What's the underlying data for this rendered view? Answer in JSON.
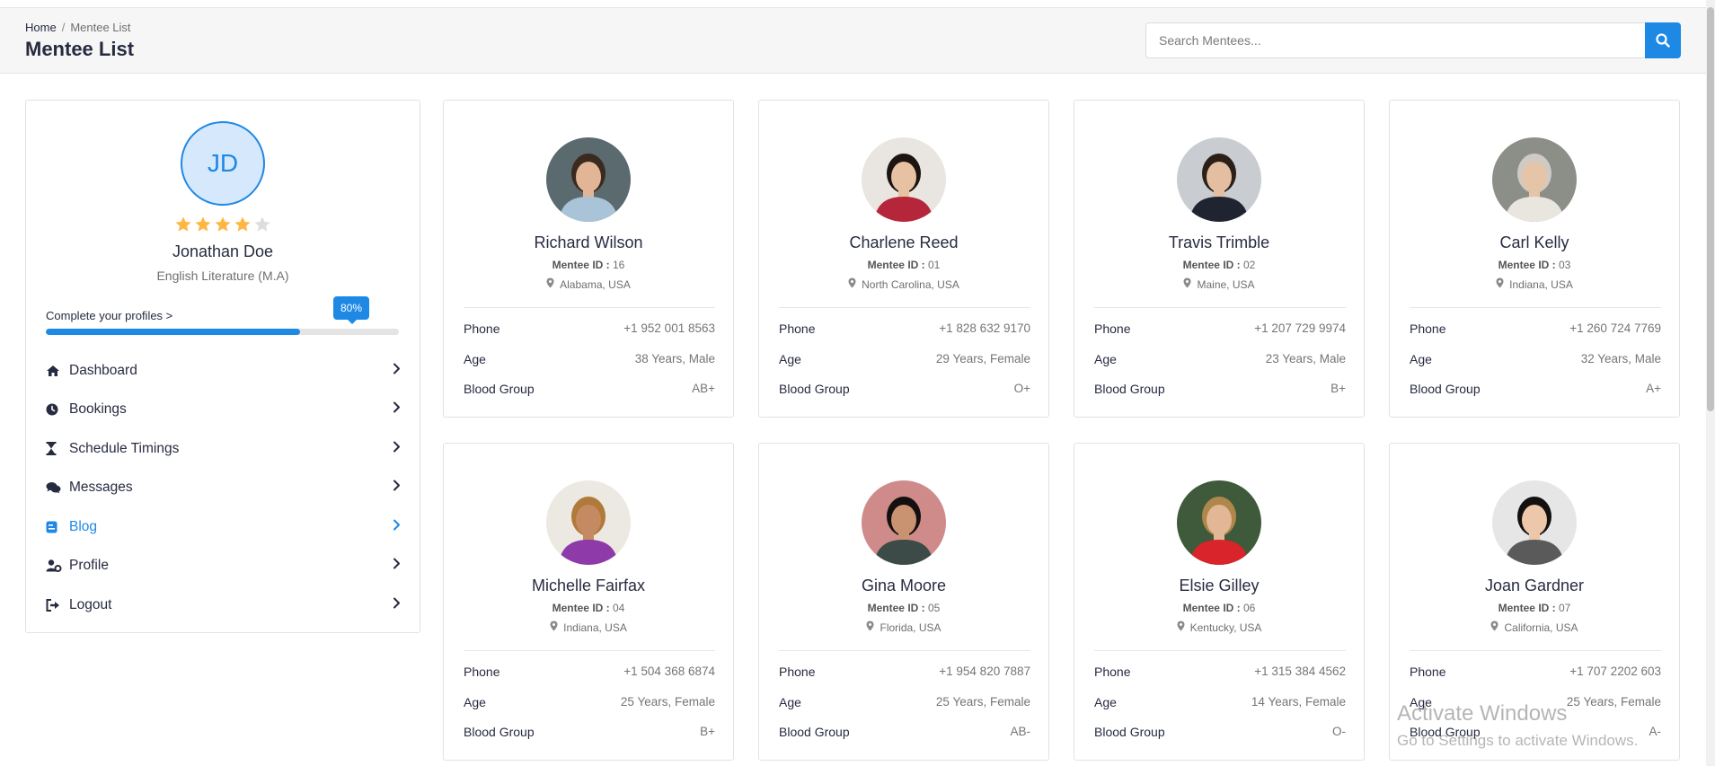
{
  "breadcrumb": {
    "home": "Home",
    "separator": "/",
    "current": "Mentee List"
  },
  "page_title": "Mentee List",
  "search": {
    "placeholder": "Search Mentees...",
    "icon": "search-icon"
  },
  "profile": {
    "initials": "JD",
    "rating": 4,
    "rating_max": 5,
    "name": "Jonathan Doe",
    "degree": "English Literature (M.A)",
    "complete_label": "Complete your profiles >",
    "progress_label": "80%",
    "progress": 0.8
  },
  "menu": [
    {
      "label": "Dashboard",
      "icon": "home-icon",
      "active": false
    },
    {
      "label": "Bookings",
      "icon": "clock-icon",
      "active": false
    },
    {
      "label": "Schedule Timings",
      "icon": "hourglass-icon",
      "active": false
    },
    {
      "label": "Messages",
      "icon": "comments-icon",
      "active": false
    },
    {
      "label": "Blog",
      "icon": "blog-icon",
      "active": true
    },
    {
      "label": "Profile",
      "icon": "user-cog-icon",
      "active": false
    },
    {
      "label": "Logout",
      "icon": "sign-out-icon",
      "active": false
    }
  ],
  "field_labels": {
    "phone": "Phone",
    "age": "Age",
    "blood": "Blood Group",
    "id_label": "Mentee ID :"
  },
  "mentees": [
    {
      "name": "Richard Wilson",
      "id": "16",
      "location": "Alabama, USA",
      "phone": "+1 952 001 8563",
      "age": "38 Years, Male",
      "blood": "AB+"
    },
    {
      "name": "Charlene Reed",
      "id": "01",
      "location": "North Carolina, USA",
      "phone": "+1 828 632 9170",
      "age": "29 Years, Female",
      "blood": "O+"
    },
    {
      "name": "Travis Trimble",
      "id": "02",
      "location": "Maine, USA",
      "phone": "+1 207 729 9974",
      "age": "23 Years, Male",
      "blood": "B+"
    },
    {
      "name": "Carl Kelly",
      "id": "03",
      "location": "Indiana, USA",
      "phone": "+1 260 724 7769",
      "age": "32 Years, Male",
      "blood": "A+"
    },
    {
      "name": "Michelle Fairfax",
      "id": "04",
      "location": "Indiana, USA",
      "phone": "+1 504 368 6874",
      "age": "25 Years, Female",
      "blood": "B+"
    },
    {
      "name": "Gina Moore",
      "id": "05",
      "location": "Florida, USA",
      "phone": "+1 954 820 7887",
      "age": "25 Years, Female",
      "blood": "AB-"
    },
    {
      "name": "Elsie Gilley",
      "id": "06",
      "location": "Kentucky, USA",
      "phone": "+1 315 384 4562",
      "age": "14 Years, Female",
      "blood": "O-"
    },
    {
      "name": "Joan Gardner",
      "id": "07",
      "location": "California, USA",
      "phone": "+1 707 2202 603",
      "age": "25 Years, Female",
      "blood": "A-"
    }
  ],
  "watermark": {
    "line1": "Activate Windows",
    "line2": "Go to Settings to activate Windows."
  },
  "colors": {
    "accent": "#1e88e5",
    "star": "#ffb743",
    "star_empty": "#dddddd",
    "text": "#272b41",
    "muted": "#757575"
  }
}
